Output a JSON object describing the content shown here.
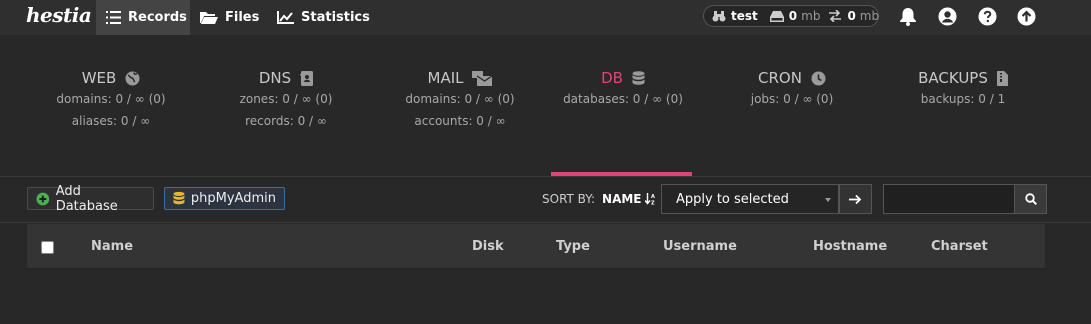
{
  "app": {
    "logo": "hestia"
  },
  "nav": {
    "records": "Records",
    "files": "Files",
    "statistics": "Statistics"
  },
  "user": {
    "name": "test",
    "disk_value": "0",
    "disk_unit": "mb",
    "bandwidth_value": "0",
    "bandwidth_unit": "mb"
  },
  "stats": [
    {
      "title": "WEB",
      "lines": [
        "domains: 0 / ∞ (0)",
        "aliases: 0 / ∞"
      ]
    },
    {
      "title": "DNS",
      "lines": [
        "zones: 0 / ∞ (0)",
        "records: 0 / ∞"
      ]
    },
    {
      "title": "MAIL",
      "lines": [
        "domains: 0 / ∞ (0)",
        "accounts: 0 / ∞"
      ]
    },
    {
      "title": "DB",
      "lines": [
        "databases: 0 / ∞ (0)"
      ]
    },
    {
      "title": "CRON",
      "lines": [
        "jobs: 0 / ∞ (0)"
      ]
    },
    {
      "title": "BACKUPS",
      "lines": [
        "backups: 0 / 1"
      ]
    }
  ],
  "toolbar": {
    "add_database": "Add Database",
    "phpmyadmin": "phpMyAdmin",
    "sort_by_label": "SORT BY:",
    "sort_by_value": "NAME",
    "bulk_action": "Apply to selected"
  },
  "table": {
    "columns": [
      "Name",
      "Disk",
      "Type",
      "Username",
      "Hostname",
      "Charset"
    ]
  },
  "colors": {
    "accent": "#e0457a",
    "background": "#282828",
    "topbar": "#2f2f2f"
  }
}
